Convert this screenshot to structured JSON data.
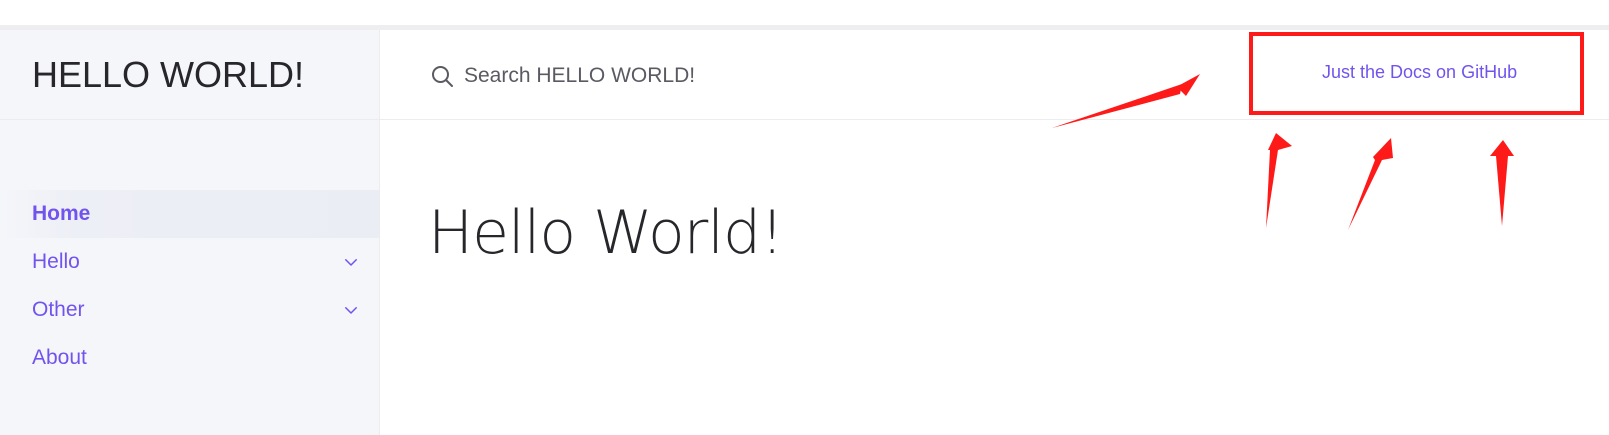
{
  "site": {
    "title": "HELLO WORLD!"
  },
  "nav": {
    "items": [
      {
        "label": "Home",
        "active": true,
        "expandable": false
      },
      {
        "label": "Hello",
        "active": false,
        "expandable": true
      },
      {
        "label": "Other",
        "active": false,
        "expandable": true
      },
      {
        "label": "About",
        "active": false,
        "expandable": false
      }
    ]
  },
  "search": {
    "placeholder": "Search HELLO WORLD!",
    "icon": "search-icon"
  },
  "aux": {
    "link_label": "Just the Docs on GitHub"
  },
  "main": {
    "heading": "Hello World!"
  },
  "colors": {
    "accent": "#7253ed",
    "sidebar_bg": "#f5f6fa",
    "text": "#27262b",
    "annotation": "#ff1a1a"
  }
}
